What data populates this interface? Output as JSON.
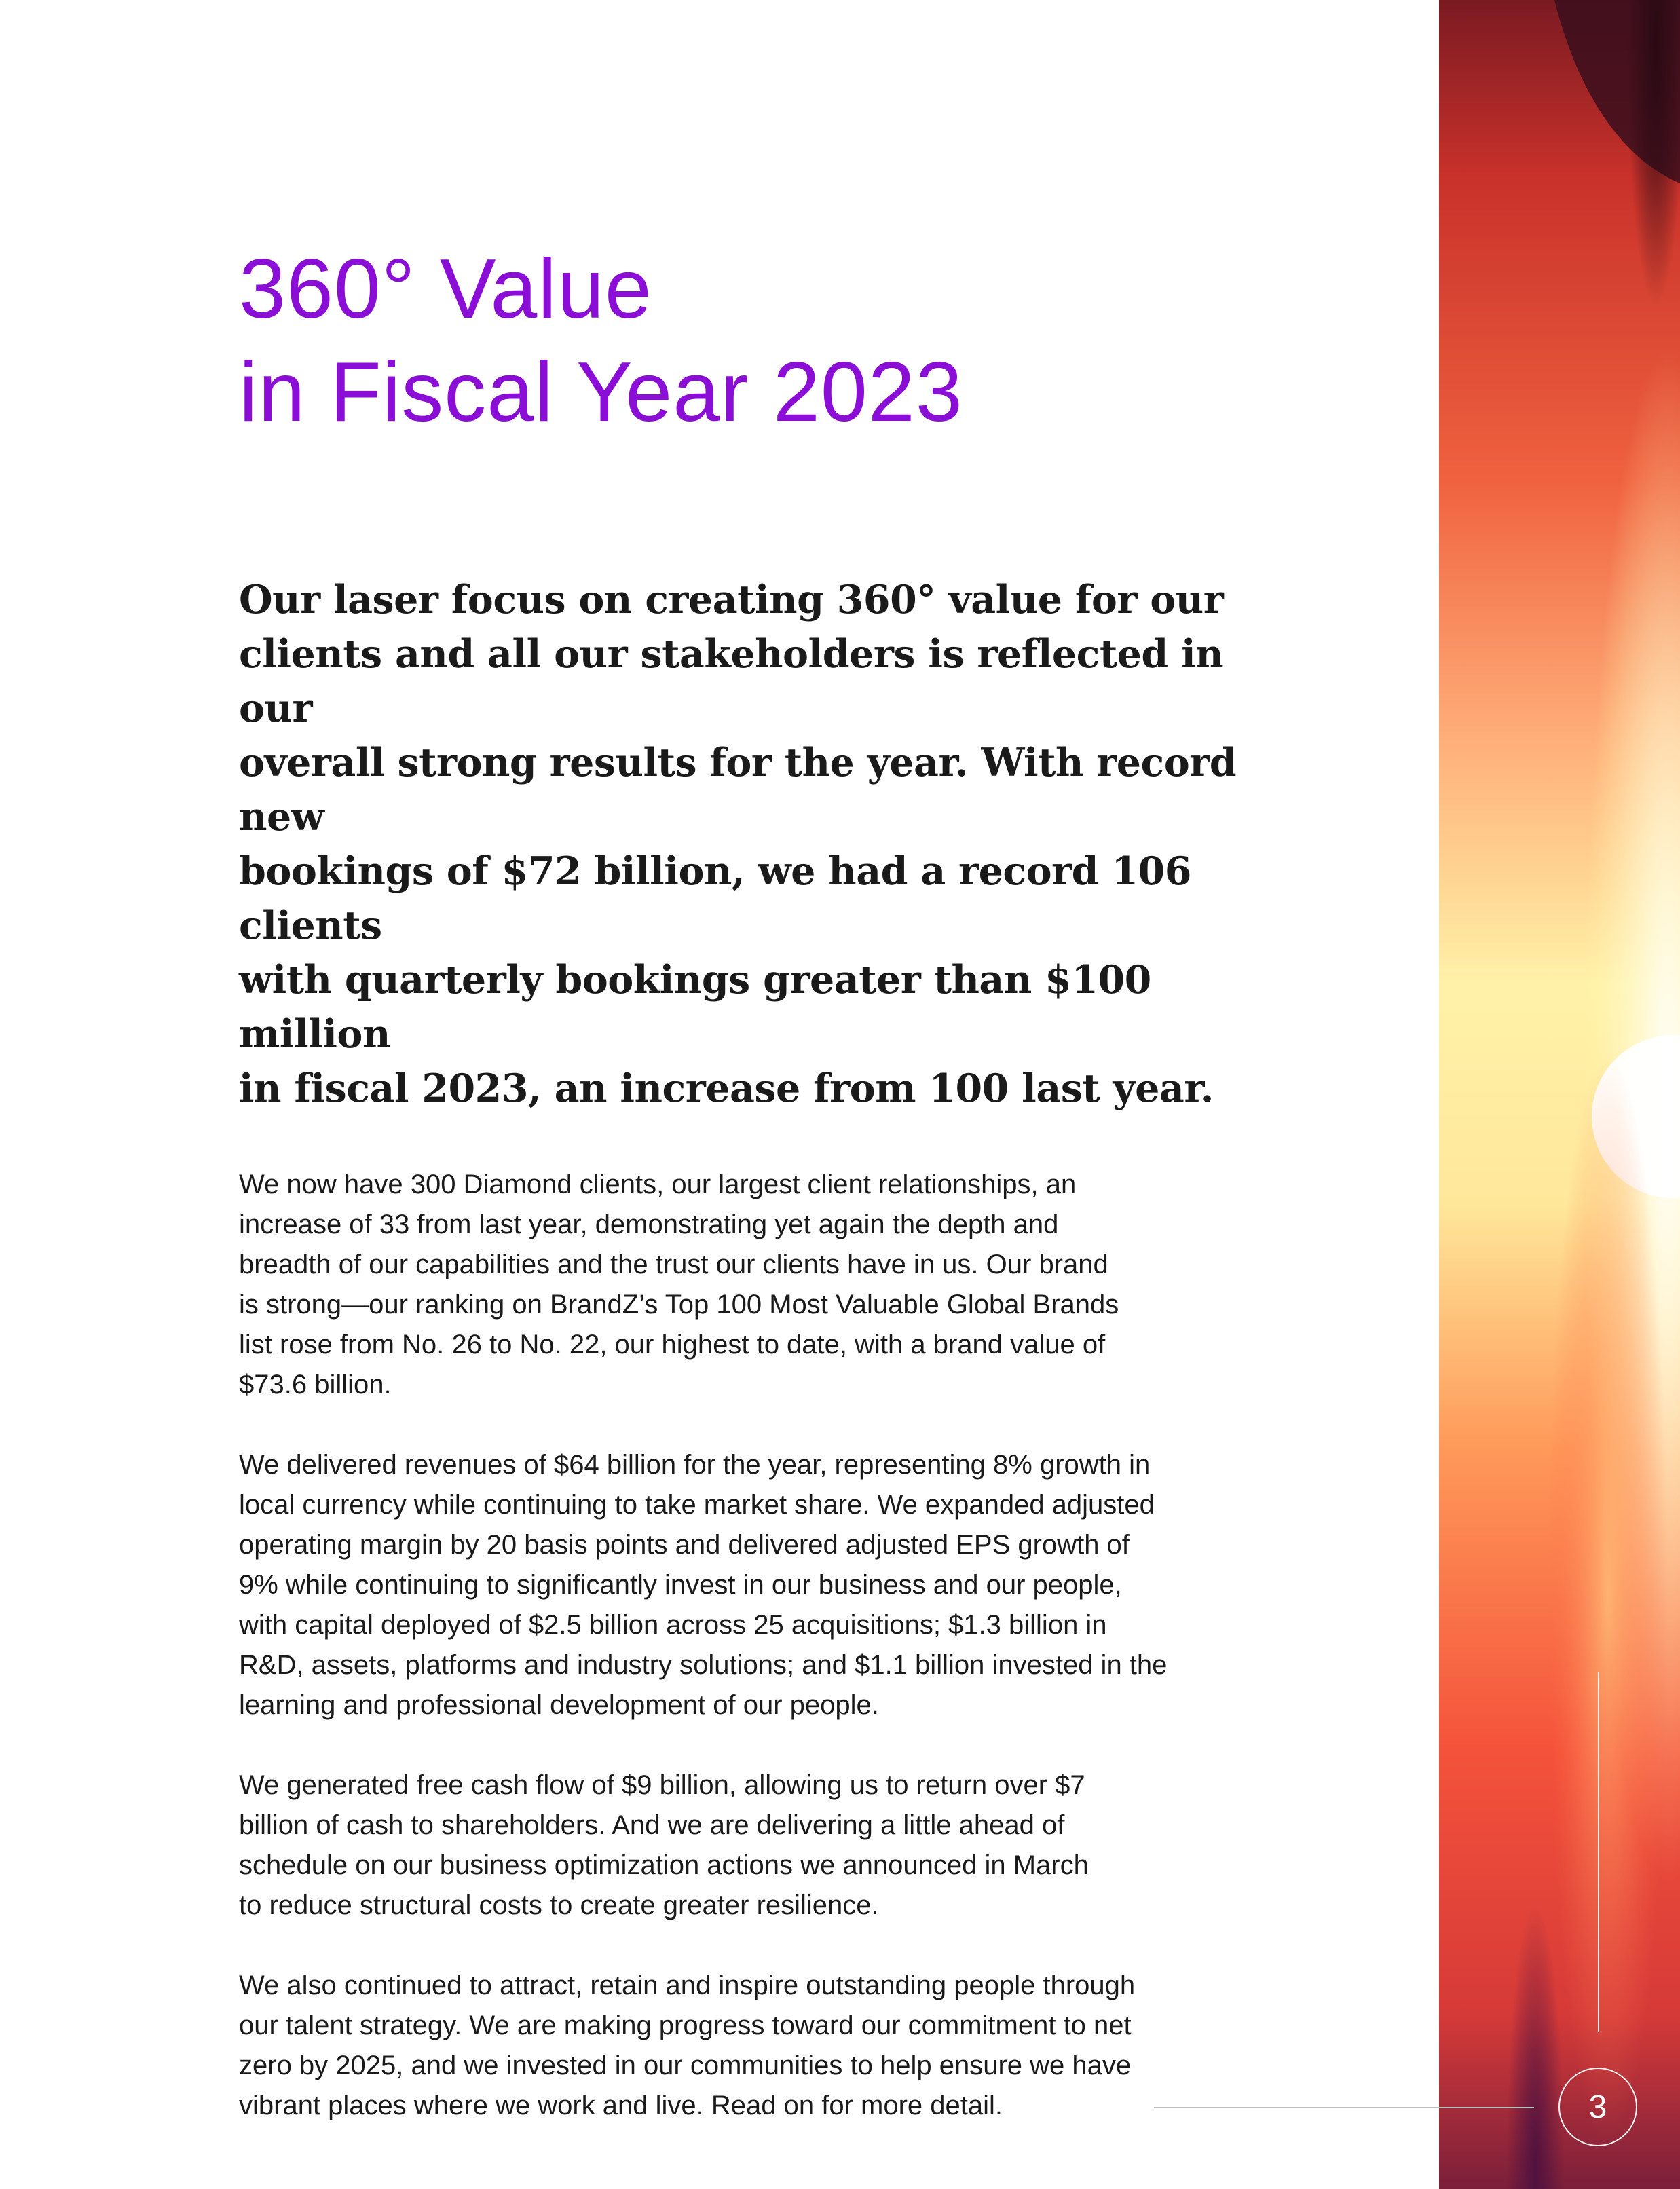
{
  "colors": {
    "accent": "#8a0ed6",
    "body_text": "#1a1a1a",
    "photo_warm": "#ff6a45",
    "photo_glow": "#fff6b0"
  },
  "title": {
    "lines": [
      "360° Value",
      "in Fiscal Year 2023"
    ]
  },
  "lede": {
    "lines": [
      "Our laser focus on creating 360° value for our",
      "clients and all our stakeholders is reflected in our",
      "overall strong results for the year. With record new",
      "bookings of $72 billion, we had a record 106 clients",
      "with quarterly bookings greater than $100 million",
      "in fiscal 2023, an increase from 100 last year."
    ]
  },
  "paragraphs": [
    {
      "lines": [
        "We now have 300 Diamond clients, our largest client relationships, an",
        "increase of 33 from last year, demonstrating yet again the depth and",
        "breadth of our capabilities and the trust our clients have in us. Our brand",
        "is strong—our ranking on BrandZ’s Top 100 Most Valuable Global Brands",
        "list rose from No. 26 to No. 22, our highest to date, with a brand value of",
        "$73.6 billion."
      ]
    },
    {
      "lines": [
        "We delivered revenues of $64 billion for the year, representing 8% growth in",
        "local currency while continuing to take market share. We expanded adjusted",
        "operating margin by 20 basis points and delivered adjusted EPS growth of",
        "9% while continuing to significantly invest in our business and our people,",
        "with capital deployed of $2.5 billion across 25 acquisitions; $1.3 billion in",
        "R&D, assets, platforms and industry solutions; and $1.1 billion invested in the",
        "learning and professional development of our people."
      ]
    },
    {
      "lines": [
        "We generated free cash flow of $9 billion, allowing us to return over $7",
        "billion of cash to shareholders. And we are delivering a little ahead of",
        "schedule on our business optimization actions we announced in March",
        "to reduce structural costs to create greater resilience."
      ]
    },
    {
      "lines": [
        "We also continued to attract, retain and inspire outstanding people through",
        "our talent strategy. We are making progress toward our commitment to net",
        "zero by 2025, and we invested in our communities to help ensure we have",
        "vibrant places where we work and live. Read on for more detail."
      ]
    }
  ],
  "page_number": "3"
}
